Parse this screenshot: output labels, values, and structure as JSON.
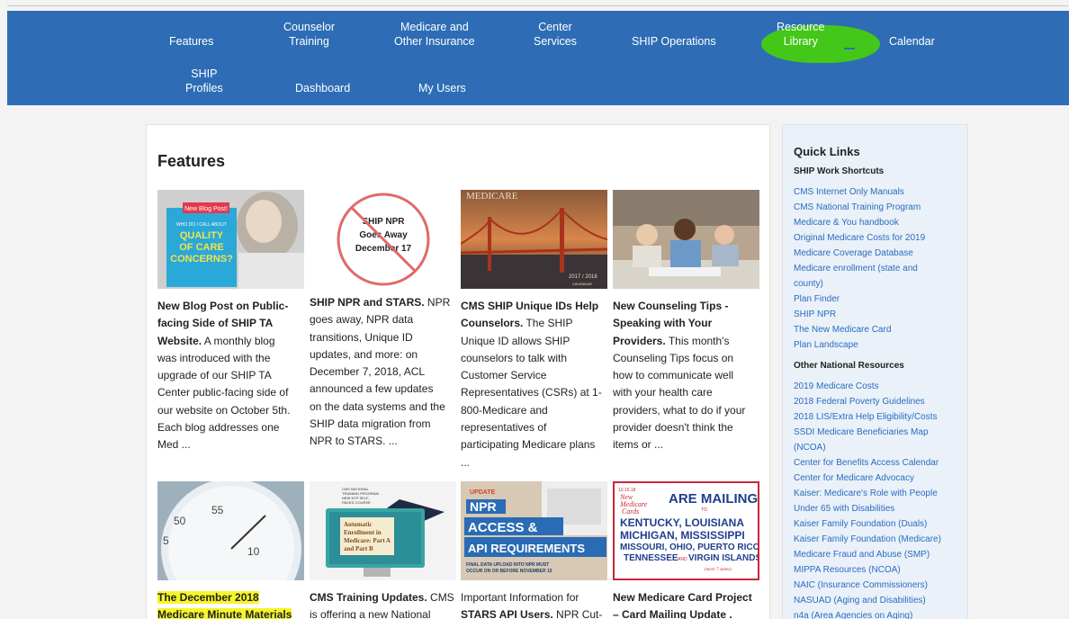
{
  "nav": {
    "row1": [
      {
        "label": "Features"
      },
      {
        "label1": "Counselor",
        "label2": "Training"
      },
      {
        "label1": "Medicare and",
        "label2": "Other Insurance"
      },
      {
        "label1": "Center",
        "label2": "Services"
      },
      {
        "label": "SHIP Operations"
      },
      {
        "label1": "Resource",
        "label2": "Library"
      },
      {
        "label": "Calendar"
      }
    ],
    "row2": [
      {
        "label1": "SHIP",
        "label2": "Profiles"
      },
      {
        "label": "Dashboard"
      },
      {
        "label": "My Users"
      }
    ]
  },
  "main": {
    "title": "Features",
    "cards": [
      {
        "img_text": {
          "badge": "New Blog Post!",
          "small": "WHO DO I CALL ABOUT",
          "big1": "QUALITY",
          "big2": "OF CARE",
          "big3": "CONCERNS?"
        },
        "lines": [
          "New Blog Post on Public-",
          "facing Side of SHIP TA",
          "Website.",
          " A monthly blog",
          "was introduced with the",
          "upgrade of our SHIP TA",
          "Center public-facing side of",
          "our website on October 5th.",
          "Each blog addresses one",
          "Med ..."
        ]
      },
      {
        "img_text": {
          "l1": "SHIP NPR",
          "l2": "Goes Away",
          "l3": "December 17"
        },
        "lines": [
          "SHIP NPR and STARS.",
          " NPR",
          "goes away, NPR data",
          "transitions, Unique ID",
          "updates, and more: on",
          "December 7, 2018, ACL",
          "announced a few updates",
          "on the data systems and the",
          "SHIP data migration from",
          "NPR to STARS. ..."
        ]
      },
      {
        "img_text": {
          "brand": "MEDICARE",
          "year": "2017 / 2018",
          "cal": "CALENDAR"
        },
        "lines": [
          "CMS SHIP Unique IDs Help",
          "Counselors.",
          " The SHIP",
          "Unique ID allows SHIP",
          "counselors to talk with",
          "Customer Service",
          "Representatives (CSRs) at 1-",
          "800-Medicare and",
          "representatives of",
          "participating Medicare plans",
          "..."
        ]
      },
      {
        "img_text": {},
        "lines": [
          "New Counseling Tips -",
          "Speaking with Your",
          "Providers.",
          " This month's",
          "Counseling Tips focus on",
          "how to communicate well",
          "with your health care",
          "providers, what to do if your",
          "provider doesn't think the",
          "items or ..."
        ]
      }
    ],
    "cards2": [
      {
        "lines": [
          "The December 2018",
          "Medicare Minute Materials"
        ]
      },
      {
        "img_text": {
          "c1": "CMS NATIONAL",
          "c2": "TRAINING PROGRAM",
          "c3": "NEW NTP SELF-",
          "c4": "PACED COURSE",
          "s1": "Automatic",
          "s2": "Enrollment in",
          "s3": "Medicare: Part A",
          "s4": "and Part B"
        },
        "lines": [
          "CMS Training Updates.",
          " CMS",
          "is offering a new National"
        ]
      },
      {
        "img_text": {
          "u": "UPDATE",
          "a": "NPR",
          "b": "ACCESS &",
          "c": "API REQUIREMENTS",
          "d": "FINAL DATA UPLOAD INTO NPR MUST",
          "e": "OCCUR ON OR BEFORE NOVEMBER 15"
        },
        "lines": [
          "Important Information for",
          "STARS API Users.",
          " NPR Cut-"
        ]
      },
      {
        "img_text": {
          "date": "10.15.18",
          "nmc1": "New",
          "nmc2": "Medicare",
          "nmc3": "Cards",
          "am": "ARE MAILING",
          "to": "TO",
          "s1": "KENTUCKY, LOUISIANA",
          "s2": "MICHIGAN, MISSISSIPPI",
          "s3": "MISSOURI, OHIO, PUERTO RICO",
          "s4": "TENNESSEE",
          "s4b": "AND",
          "s5": "VIRGIN ISLANDS",
          "more": "(more 7 states)"
        },
        "lines": [
          "New Medicare Card Project",
          "– Card Mailing Update ."
        ]
      }
    ]
  },
  "sidebar": {
    "title": "Quick Links",
    "section1": "SHIP Work Shortcuts",
    "links1": [
      "CMS Internet Only Manuals",
      "CMS National Training Program",
      "Medicare & You handbook",
      "Original Medicare Costs for 2019",
      "Medicare Coverage Database",
      "Medicare enrollment (state and",
      "county)",
      "Plan Finder",
      "SHIP NPR",
      "The New Medicare Card",
      "Plan Landscape"
    ],
    "section2": "Other National Resources",
    "links2": [
      "2019 Medicare Costs",
      "2018 Federal Poverty Guidelines",
      "2018 LIS/Extra Help Eligibility/Costs",
      "SSDI Medicare Beneficiaries Map",
      "(NCOA)",
      "Center for Benefits Access Calendar",
      "Center for Medicare Advocacy",
      "Kaiser: Medicare's Role with People",
      "Under 65 with Disabilities",
      "Kaiser Family Foundation (Duals)",
      "Kaiser Family Foundation (Medicare)",
      "Medicare Fraud and Abuse (SMP)",
      "MIPPA Resources (NCOA)",
      "NAIC (Insurance Commissioners)",
      "NASUAD (Aging and Disabilities)",
      "n4a (Area Agencies on Aging)"
    ]
  },
  "colors": {
    "nav_bg": "#2e6db5",
    "link": "#2b6cc2",
    "highlight_green": "#44cc11",
    "highlight_yellow": "#f5f52a"
  }
}
